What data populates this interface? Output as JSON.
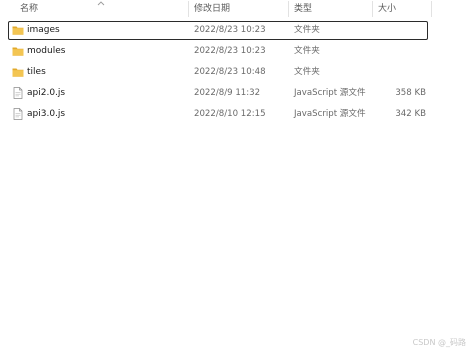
{
  "columns": {
    "name": "名称",
    "modified": "修改日期",
    "type": "类型",
    "size": "大小"
  },
  "files": [
    {
      "name": "images",
      "modified": "2022/8/23 10:23",
      "type": "文件夹",
      "size": "",
      "icon": "folder-icon",
      "selected": true
    },
    {
      "name": "modules",
      "modified": "2022/8/23 10:23",
      "type": "文件夹",
      "size": "",
      "icon": "folder-icon",
      "selected": false
    },
    {
      "name": "tiles",
      "modified": "2022/8/23 10:48",
      "type": "文件夹",
      "size": "",
      "icon": "folder-icon",
      "selected": false
    },
    {
      "name": "api2.0.js",
      "modified": "2022/8/9 11:32",
      "type": "JavaScript 源文件",
      "size": "358 KB",
      "icon": "js-file-icon",
      "selected": false
    },
    {
      "name": "api3.0.js",
      "modified": "2022/8/10 12:15",
      "type": "JavaScript 源文件",
      "size": "342 KB",
      "icon": "js-file-icon",
      "selected": false
    }
  ],
  "watermark": "CSDN @_码路",
  "colors": {
    "folder": "#f3c552",
    "folder_dark": "#e2a92a",
    "file_border": "#8a8a8a",
    "selection_border": "#2b2b2b"
  }
}
